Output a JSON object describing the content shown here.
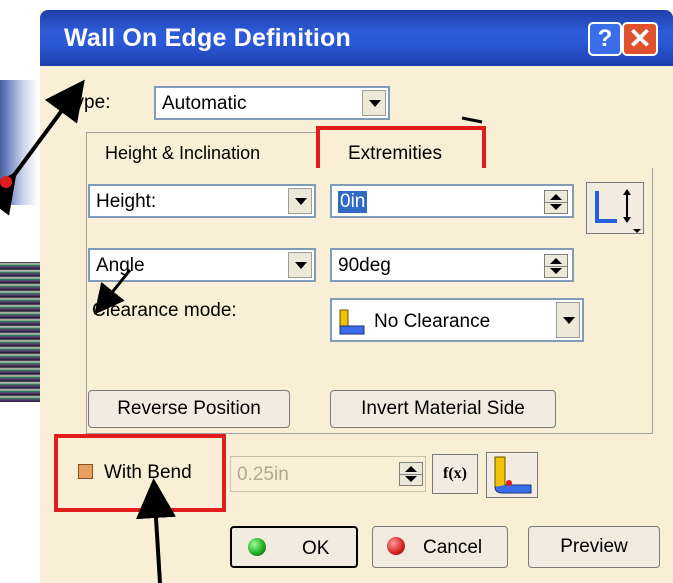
{
  "window": {
    "title": "Wall On Edge Definition",
    "help_label": "?",
    "close_label": "✕"
  },
  "type": {
    "label": "Type:",
    "value": "Automatic"
  },
  "tabs": [
    {
      "label": "Height & Inclination"
    },
    {
      "label": "Extremities"
    }
  ],
  "height": {
    "mode": "Height:",
    "value": "0in"
  },
  "angle": {
    "mode": "Angle",
    "value": "90deg"
  },
  "clearance": {
    "label": "Clearance mode:",
    "value": "No Clearance"
  },
  "buttons": {
    "reverse_position": "Reverse Position",
    "invert_material_side": "Invert Material Side",
    "ok": "OK",
    "cancel": "Cancel",
    "preview": "Preview"
  },
  "bend": {
    "label": "With Bend",
    "radius": "0.25in",
    "formula_label": "f(x)"
  },
  "colors": {
    "title_blue": "#2b58d6",
    "dialog_bg": "#f8efd6",
    "highlight_red": "#e11c1c",
    "ok_green": "#1aa51a",
    "cancel_red": "#d42020"
  }
}
